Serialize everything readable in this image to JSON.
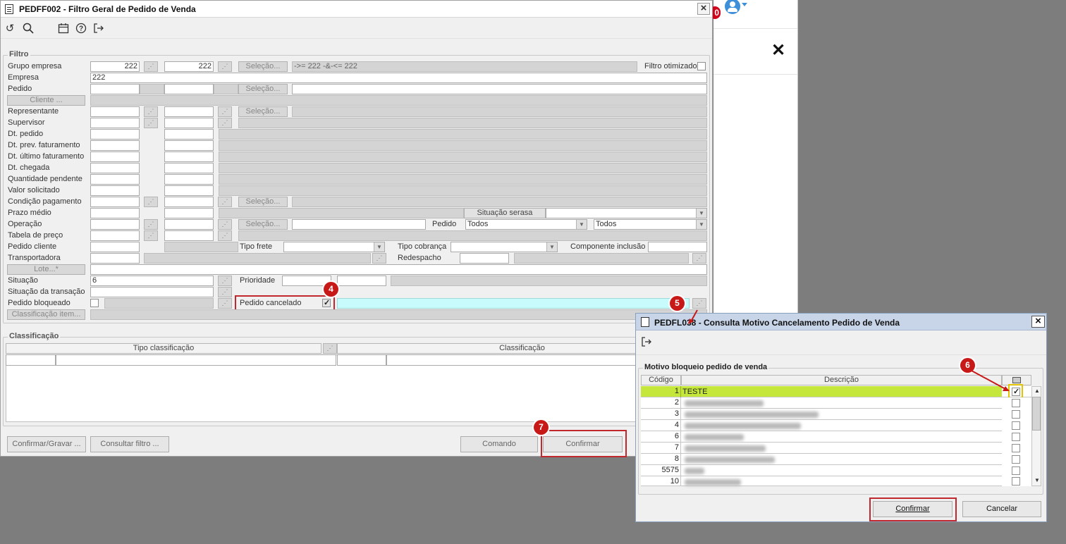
{
  "background_window": {
    "notification_count": "0"
  },
  "main_window": {
    "title": "PEDFF002 - Filtro Geral de Pedido de Venda",
    "filter_group_title": "Filtro",
    "fields": {
      "grupo_empresa": {
        "label": "Grupo empresa",
        "from": "222",
        "to": "222",
        "selection_button": "Seleção...",
        "expression": "->= 222 -&-<= 222"
      },
      "filtro_otimizado": {
        "label": "Filtro otimizado"
      },
      "empresa": {
        "label": "Empresa",
        "value": "222"
      },
      "pedido": {
        "label": "Pedido",
        "selection_button": "Seleção..."
      },
      "cliente": {
        "button": "Cliente ..."
      },
      "representante": {
        "label": "Representante",
        "selection_button": "Seleção..."
      },
      "supervisor": {
        "label": "Supervisor"
      },
      "dt_pedido": {
        "label": "Dt. pedido"
      },
      "dt_prev_faturamento": {
        "label": "Dt. prev. faturamento"
      },
      "dt_ultimo_faturamento": {
        "label": "Dt. último faturamento"
      },
      "dt_chegada": {
        "label": "Dt. chegada"
      },
      "quantidade_pendente": {
        "label": "Quantidade pendente"
      },
      "valor_solicitado": {
        "label": "Valor solicitado"
      },
      "condicao_pagamento": {
        "label": "Condição pagamento",
        "selection_button": "Seleção..."
      },
      "prazo_medio": {
        "label": "Prazo médio"
      },
      "situacao_serasa": {
        "label": "Situação serasa"
      },
      "operacao": {
        "label": "Operação",
        "selection_button": "Seleção..."
      },
      "pedido_tipo": {
        "label": "Pedido",
        "value1": "Todos",
        "value2": "Todos"
      },
      "tabela_preco": {
        "label": "Tabela de preço"
      },
      "pedido_cliente": {
        "label": "Pedido cliente"
      },
      "tipo_frete": {
        "label": "Tipo frete"
      },
      "tipo_cobranca": {
        "label": "Tipo cobrança"
      },
      "componente_inclusao": {
        "label": "Componente inclusão"
      },
      "transportadora": {
        "label": "Transportadora"
      },
      "redespacho": {
        "label": "Redespacho"
      },
      "lote": {
        "button": "Lote...*"
      },
      "situacao": {
        "label": "Situação",
        "value": "6"
      },
      "prioridade": {
        "label": "Prioridade"
      },
      "situacao_transacao": {
        "label": "Situação da transação"
      },
      "pedido_bloqueado": {
        "label": "Pedido bloqueado"
      },
      "pedido_cancelado": {
        "label": "Pedido cancelado"
      },
      "classificacao_item": {
        "button": "Classificação item..."
      }
    },
    "classification_group_title": "Classificação",
    "classification_columns": [
      "Tipo classificação",
      "Classificação"
    ],
    "bottom_buttons": {
      "confirmar_gravar": "Confirmar/Gravar ...",
      "consultar_filtro": "Consultar filtro ...",
      "comando": "Comando",
      "confirmar": "Confirmar"
    }
  },
  "dialog": {
    "title": "PEDFL038 - Consulta Motivo Cancelamento Pedido de Venda",
    "group_title": "Motivo bloqueio pedido de venda",
    "columns": {
      "codigo": "Código",
      "descricao": "Descrição"
    },
    "rows": [
      {
        "code": "1",
        "description": "TESTE",
        "checked": true
      },
      {
        "code": "2",
        "description": "",
        "checked": false
      },
      {
        "code": "3",
        "description": "",
        "checked": false
      },
      {
        "code": "4",
        "description": "",
        "checked": false
      },
      {
        "code": "6",
        "description": "",
        "checked": false
      },
      {
        "code": "7",
        "description": "",
        "checked": false
      },
      {
        "code": "8",
        "description": "",
        "checked": false
      },
      {
        "code": "5575",
        "description": "",
        "checked": false
      },
      {
        "code": "10",
        "description": "",
        "checked": false
      }
    ],
    "buttons": {
      "confirmar": "Confirmar",
      "cancelar": "Cancelar"
    }
  },
  "markers": {
    "m4": "4",
    "m5": "5",
    "m6": "6",
    "m7": "7"
  }
}
